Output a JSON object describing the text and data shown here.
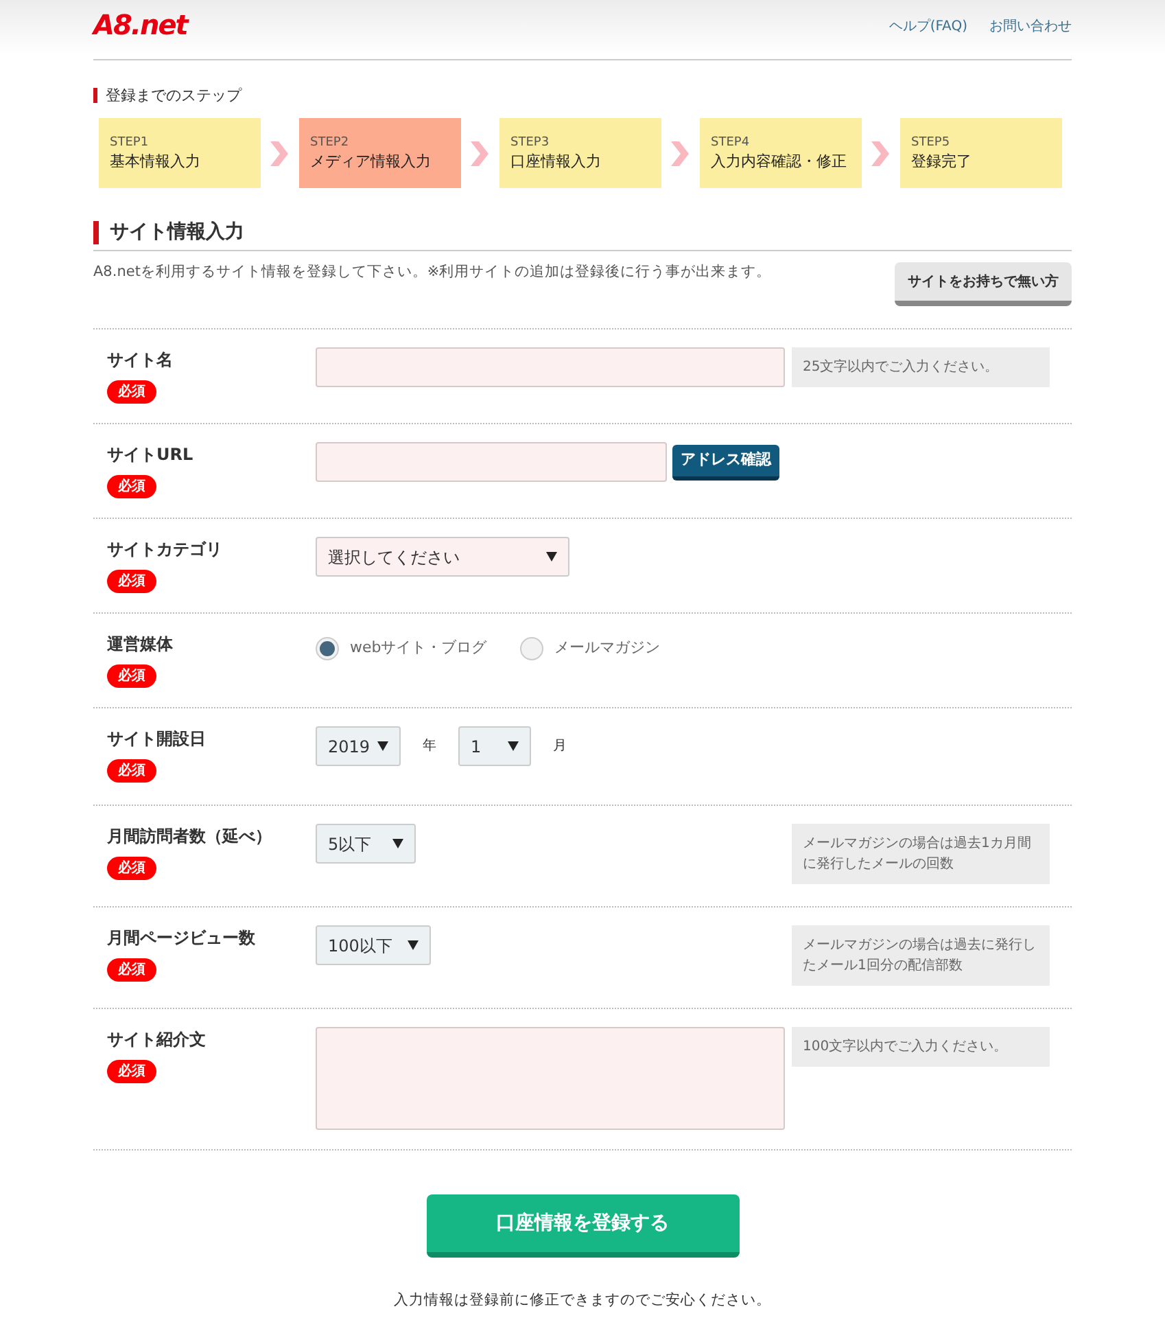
{
  "header": {
    "logo": "A8.net",
    "links": [
      "ヘルプ(FAQ)",
      "お問い合わせ"
    ]
  },
  "steps_title": "登録までのステップ",
  "steps": [
    {
      "step": "STEP1",
      "label": "基本情報入力",
      "selected": false
    },
    {
      "step": "STEP2",
      "label": "メディア情報入力",
      "selected": true
    },
    {
      "step": "STEP3",
      "label": "口座情報入力",
      "selected": false
    },
    {
      "step": "STEP4",
      "label": "入力内容確認・修正",
      "selected": false
    },
    {
      "step": "STEP5",
      "label": "登録完了",
      "selected": false
    }
  ],
  "section_title": "サイト情報入力",
  "intro": "A8.netを利用するサイト情報を登録して下さい。※利用サイトの追加は登録後に行う事が出来ます。",
  "no_site_button": "サイトをお持ちで無い方",
  "fields": [
    {
      "label": "サイト名",
      "required": "必須",
      "kind": "text",
      "hint": "25文字以内でご入力ください。"
    },
    {
      "label": "サイトURL",
      "required": "必須",
      "kind": "url",
      "button": "アドレス確認"
    },
    {
      "label": "サイトカテゴリ",
      "required": "必須",
      "kind": "select",
      "value": "選択してください"
    },
    {
      "label": "運営媒体",
      "required": "必須",
      "kind": "radio",
      "options": [
        {
          "label": "webサイト・ブログ",
          "selected": true
        },
        {
          "label": "メールマガジン",
          "selected": false
        }
      ]
    },
    {
      "label": "サイト開設日",
      "required": "必須",
      "kind": "date",
      "year": "2019",
      "year_unit": "年",
      "month": "1",
      "month_unit": "月"
    },
    {
      "label": "月間訪問者数（延べ）",
      "required": "必須",
      "kind": "small_select",
      "value": "5以下",
      "hint": "メールマガジンの場合は過去1カ月間に発行したメールの回数"
    },
    {
      "label": "月間ページビュー数",
      "required": "必須",
      "kind": "small_select",
      "value": "100以下",
      "hint": "メールマガジンの場合は過去に発行したメール1回分の配信部数"
    },
    {
      "label": "サイト紹介文",
      "required": "必須",
      "kind": "textarea",
      "hint": "100文字以内でご入力ください。"
    }
  ],
  "submit": "口座情報を登録する",
  "note": "入力情報は登録前に修正できますのでご安心ください。"
}
